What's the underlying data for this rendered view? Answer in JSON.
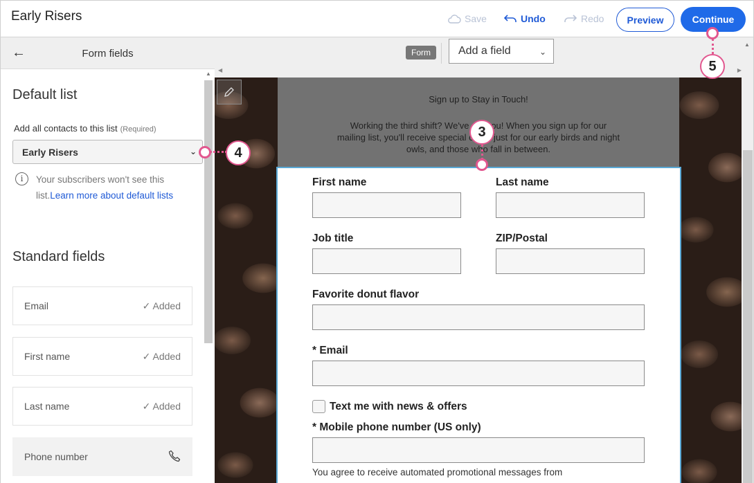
{
  "app": {
    "title": "Early Risers"
  },
  "toolbar": {
    "save": "Save",
    "undo": "Undo",
    "redo": "Redo",
    "preview": "Preview",
    "continue": "Continue"
  },
  "left_panel": {
    "header": "Form fields",
    "default_list": {
      "title": "Default list",
      "label": "Add all contacts to this list",
      "required": "(Required)",
      "selected": "Early Risers",
      "info_text": "Your subscribers won't see this list.",
      "info_link": "Learn more about default lists"
    },
    "standard_fields": {
      "title": "Standard fields",
      "items": [
        {
          "name": "Email",
          "status": "Added"
        },
        {
          "name": "First name",
          "status": "Added"
        },
        {
          "name": "Last name",
          "status": "Added"
        },
        {
          "name": "Phone number"
        }
      ]
    }
  },
  "canvas": {
    "form_badge": "Form",
    "add_field": "Add a field",
    "form_header": {
      "title": "Sign up to Stay in Touch!",
      "body_line1": "Working the third shift? We've got you! When you sign up for our",
      "body_line2": "mailing list, you'll receive special offers just for our early birds and night",
      "body_line3": "owls, and those who fall in between."
    },
    "fields": {
      "first_name": "First name",
      "last_name": "Last name",
      "job_title": "Job title",
      "zip": "ZIP/Postal",
      "donut": "Favorite donut flavor",
      "email": "* Email",
      "text_me": "Text me with news & offers",
      "mobile": "* Mobile phone number (US only)"
    },
    "agree_text": "You agree to receive automated promotional messages from"
  },
  "callouts": {
    "c3": "3",
    "c4": "4",
    "c5": "5"
  },
  "colors": {
    "accent": "#1f6ae8",
    "callout": "#e2578f",
    "form_border": "#5aa9d6"
  }
}
